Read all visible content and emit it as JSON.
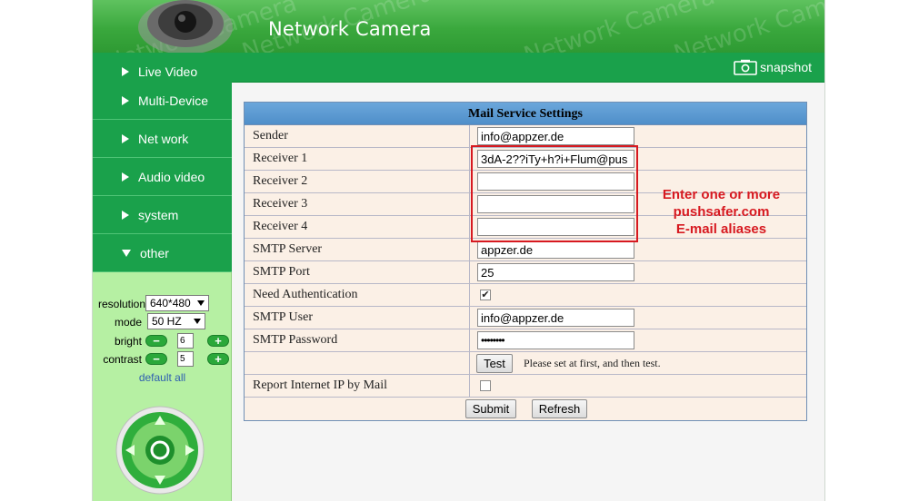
{
  "header": {
    "title": "Network Camera",
    "watermark": "Network Camera"
  },
  "sidebar": {
    "nav": [
      {
        "label": "Live Video",
        "expanded": false
      },
      {
        "label": "Multi-Device",
        "expanded": false
      },
      {
        "label": "Net work",
        "expanded": false
      },
      {
        "label": "Audio video",
        "expanded": false
      },
      {
        "label": "system",
        "expanded": false
      },
      {
        "label": "other",
        "expanded": true
      }
    ],
    "controls": {
      "resolution": {
        "label": "resolution",
        "value": "640*480"
      },
      "mode": {
        "label": "mode",
        "value": "50 HZ"
      },
      "bright": {
        "label": "bright",
        "value": "6",
        "minus": "−",
        "plus": "+"
      },
      "contrast": {
        "label": "contrast",
        "value": "5",
        "minus": "−",
        "plus": "+"
      },
      "default_all": "default all"
    }
  },
  "topbar": {
    "snapshot_label": "snapshot"
  },
  "mail": {
    "title": "Mail Service Settings",
    "rows": {
      "sender": {
        "label": "Sender",
        "value": "info@appzer.de"
      },
      "receiver1": {
        "label": "Receiver 1",
        "value": "3dA-2??iTy+h?i+Flum@pus"
      },
      "receiver2": {
        "label": "Receiver 2",
        "value": ""
      },
      "receiver3": {
        "label": "Receiver 3",
        "value": ""
      },
      "receiver4": {
        "label": "Receiver 4",
        "value": ""
      },
      "smtp_server": {
        "label": "SMTP Server",
        "value": "appzer.de"
      },
      "smtp_port": {
        "label": "SMTP Port",
        "value": "25"
      },
      "need_auth": {
        "label": "Need Authentication",
        "checked": "✔"
      },
      "smtp_user": {
        "label": "SMTP User",
        "value": "info@appzer.de"
      },
      "smtp_password": {
        "label": "SMTP Password",
        "value": "••••••••"
      },
      "test": {
        "button": "Test",
        "hint": "Please set at first, and then test."
      },
      "report_ip": {
        "label": "Report Internet IP by Mail",
        "checked": ""
      }
    },
    "submit_label": "Submit",
    "refresh_label": "Refresh"
  },
  "annotation": {
    "line1": "Enter one or more",
    "line2": "pushsafer.com",
    "line3": "E-mail aliases"
  },
  "colors": {
    "header_green": "#3aa83d",
    "nav_green": "#1aa14b",
    "sidebar_bg": "#b6f0a3",
    "title_blue": "#5b9bd5",
    "annotation_red": "#d71920"
  }
}
